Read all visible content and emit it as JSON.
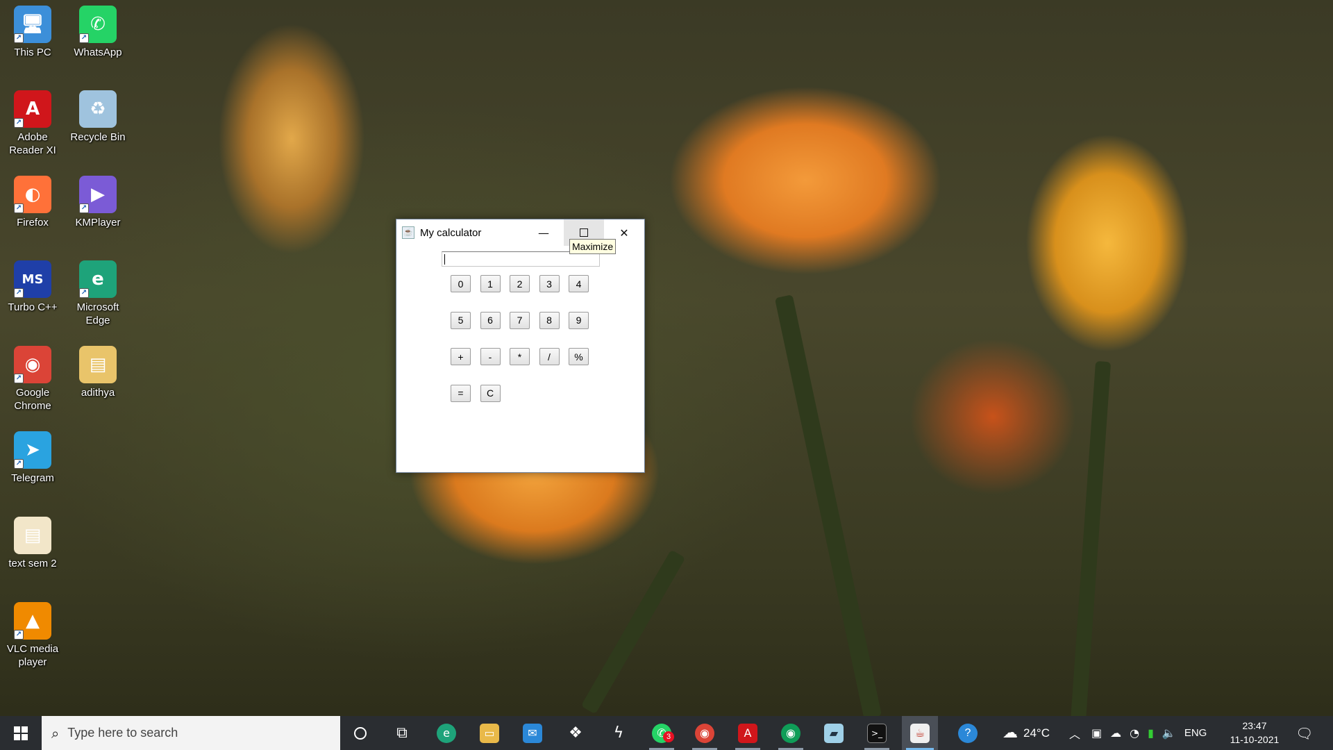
{
  "desktop": {
    "icons": [
      {
        "label": "This PC",
        "icon": "computer-icon",
        "color": "#3c8fd9"
      },
      {
        "label": "WhatsApp",
        "icon": "whatsapp-icon",
        "color": "#25d366"
      },
      {
        "label": "Adobe Reader XI",
        "icon": "adobe-reader-icon",
        "color": "#d0161b"
      },
      {
        "label": "Recycle Bin",
        "icon": "recycle-bin-icon",
        "color": "#9fc3de"
      },
      {
        "label": "Firefox",
        "icon": "firefox-icon",
        "color": "#ff7139"
      },
      {
        "label": "KMPlayer",
        "icon": "kmplayer-icon",
        "color": "#7b5bd6"
      },
      {
        "label": "Turbo C++",
        "icon": "turbo-cpp-icon",
        "color": "#1f3fa8"
      },
      {
        "label": "Microsoft Edge",
        "icon": "edge-icon",
        "color": "#1ea37a"
      },
      {
        "label": "Google Chrome",
        "icon": "chrome-icon",
        "color": "#db4437"
      },
      {
        "label": "adithya",
        "icon": "folder-icon",
        "color": "#e9c46a"
      },
      {
        "label": "Telegram",
        "icon": "telegram-icon",
        "color": "#2aa3e0"
      },
      {
        "label": "text sem 2",
        "icon": "pdf-file-icon",
        "color": "#f2e6c9"
      },
      {
        "label": "VLC media player",
        "icon": "vlc-icon",
        "color": "#f08a00"
      }
    ]
  },
  "calculator": {
    "title": "My calculator",
    "display_value": "",
    "tooltip": "Maximize",
    "row1": [
      "0",
      "1",
      "2",
      "3",
      "4"
    ],
    "row2": [
      "5",
      "6",
      "7",
      "8",
      "9"
    ],
    "row3": [
      "+",
      "-",
      "*",
      "/",
      "%"
    ],
    "row4": [
      "=",
      "C"
    ]
  },
  "taskbar": {
    "search_placeholder": "Type here to search",
    "whatsapp_badge": "3",
    "weather": "24°C",
    "language": "ENG",
    "time": "23:47",
    "date": "11-10-2021"
  }
}
